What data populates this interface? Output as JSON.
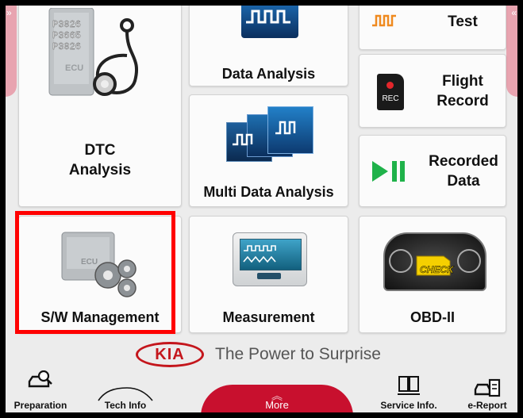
{
  "tiles": {
    "dtc": {
      "line1": "DTC",
      "line2": "Analysis"
    },
    "data_analysis": {
      "label": "Data Analysis"
    },
    "test": {
      "label": "Test"
    },
    "flight_record": {
      "line1": "Flight",
      "line2": "Record",
      "rec_badge": "REC"
    },
    "multi_data": {
      "label": "Multi Data Analysis"
    },
    "recorded_data": {
      "line1": "Recorded",
      "line2": "Data"
    },
    "sw_management": {
      "label": "S/W Management"
    },
    "measurement": {
      "label": "Measurement"
    },
    "obd": {
      "label": "OBD-II",
      "check_text": "CHECK"
    }
  },
  "dtc_codes": [
    "P3026",
    "P3665",
    "P3026"
  ],
  "ecu_label": "ECU",
  "brand": {
    "logo": "KIA",
    "tagline": "The Power to Surprise"
  },
  "nav": {
    "preparation": "Preparation",
    "tech_info": "Tech Info",
    "more": "More",
    "service_info": "Service Info.",
    "ereport": "e-Report"
  },
  "colors": {
    "highlight": "#ff0000",
    "kia_red": "#c4161c",
    "more_tab": "#c8102e",
    "play_green": "#1fb24a"
  }
}
